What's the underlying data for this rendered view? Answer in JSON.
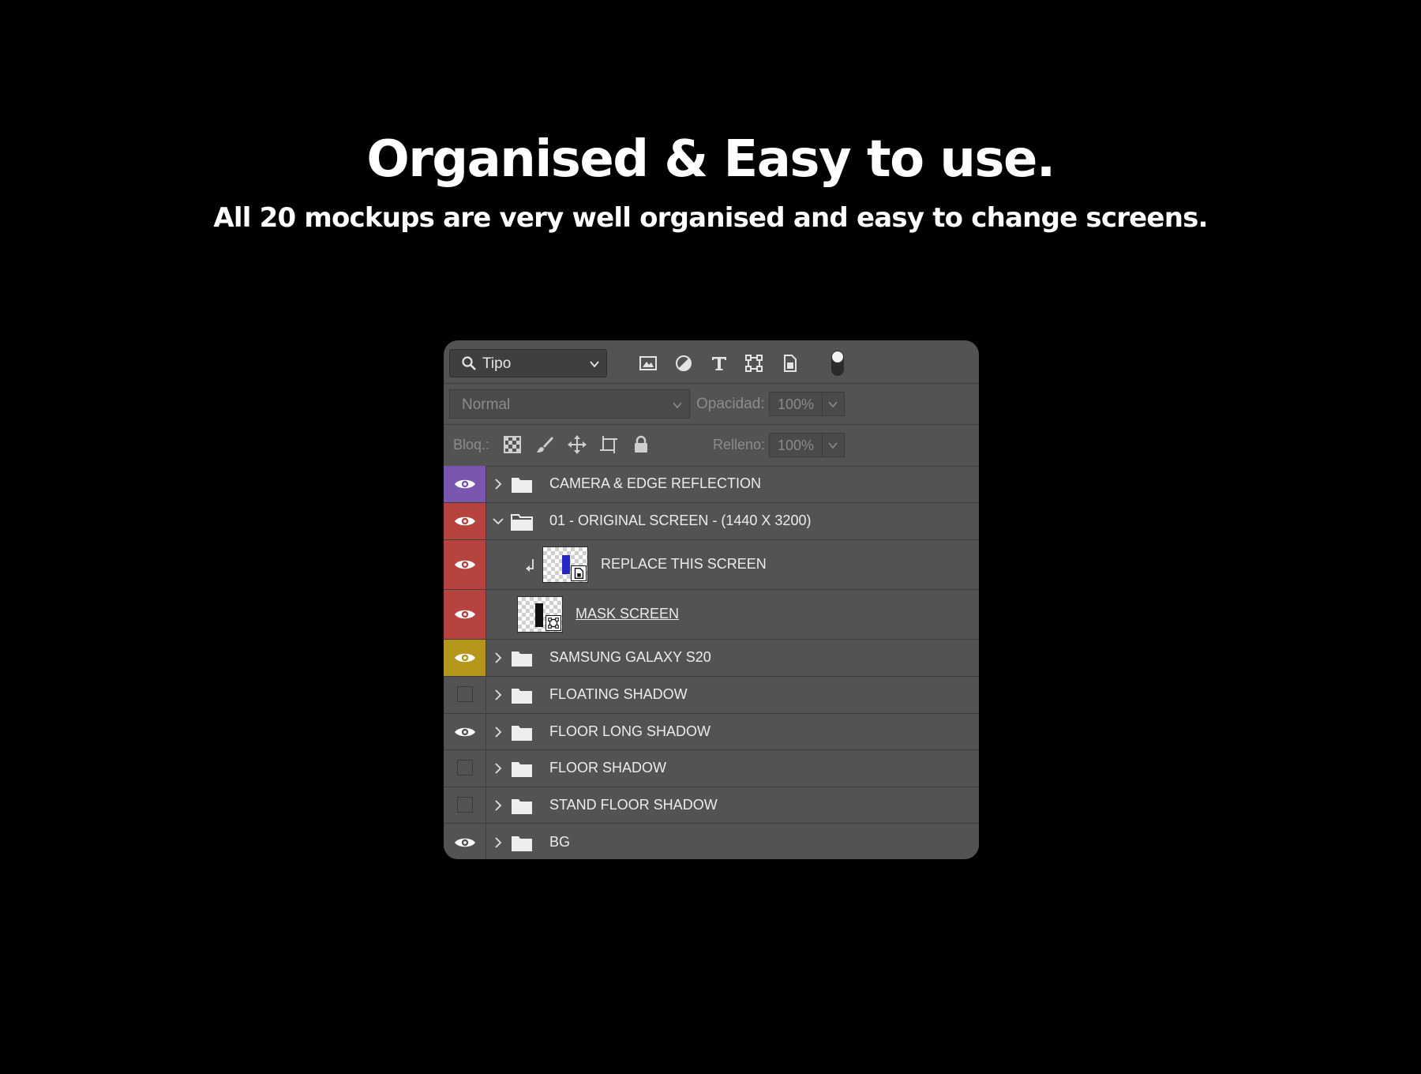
{
  "headline": "Organised & Easy to use.",
  "subheadline": "All 20 mockups are very well organised and easy to change screens.",
  "panel": {
    "filter_kind": "Tipo",
    "filter_icons": [
      "image-filter-icon",
      "adjustment-filter-icon",
      "type-filter-icon",
      "shape-filter-icon",
      "smart-object-filter-icon"
    ],
    "blend_mode": "Normal",
    "opacity_label": "Opacidad:",
    "opacity_value": "100%",
    "lock_label": "Bloq.:",
    "lock_icons": [
      "lock-transparent-icon",
      "lock-image-icon",
      "lock-position-icon",
      "lock-artboard-icon",
      "lock-all-icon"
    ],
    "fill_label": "Relleno:",
    "fill_value": "100%"
  },
  "layers": [
    {
      "name": "CAMERA & EDGE REFLECTION",
      "type": "group",
      "expanded": false,
      "visible": true,
      "color": "#7a56b0"
    },
    {
      "name": "01 - ORIGINAL SCREEN - (1440 X 3200)",
      "type": "group",
      "expanded": true,
      "visible": true,
      "color": "#b7433f"
    },
    {
      "name": "REPLACE THIS SCREEN",
      "type": "smart-object",
      "clipped": true,
      "visible": true,
      "color": "#b7433f"
    },
    {
      "name": "MASK SCREEN",
      "type": "smart-object",
      "visible": true,
      "color": "#b7433f"
    },
    {
      "name": "SAMSUNG GALAXY S20",
      "type": "group",
      "expanded": false,
      "visible": true,
      "color": "#b3961a"
    },
    {
      "name": "FLOATING SHADOW",
      "type": "group",
      "expanded": false,
      "visible": false,
      "color": ""
    },
    {
      "name": "FLOOR LONG SHADOW",
      "type": "group",
      "expanded": false,
      "visible": true,
      "color": ""
    },
    {
      "name": "FLOOR SHADOW",
      "type": "group",
      "expanded": false,
      "visible": false,
      "color": ""
    },
    {
      "name": "STAND FLOOR SHADOW",
      "type": "group",
      "expanded": false,
      "visible": false,
      "color": ""
    },
    {
      "name": "BG",
      "type": "group",
      "expanded": false,
      "visible": true,
      "color": ""
    }
  ]
}
